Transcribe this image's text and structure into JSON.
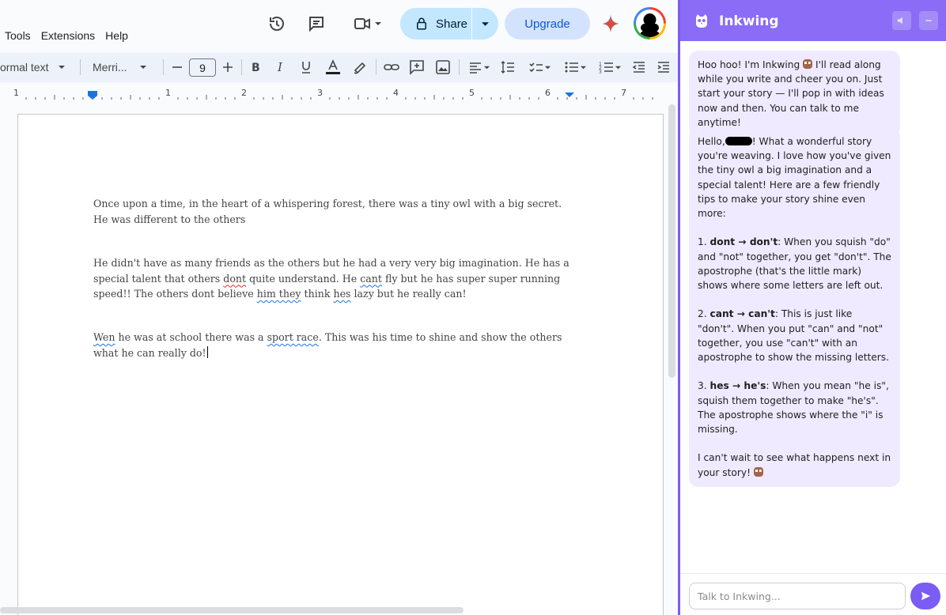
{
  "docs": {
    "menu": [
      "Tools",
      "Extensions",
      "Help"
    ],
    "share_label": "Share",
    "upgrade_label": "Upgrade",
    "toolbar": {
      "style_label": "ormal text",
      "font_label": "Merri...",
      "font_size": "9"
    },
    "ruler_numbers": [
      "1",
      "1",
      "2",
      "3",
      "4",
      "5",
      "6",
      "7"
    ],
    "document": {
      "paragraph1": "Once upon a time, in the heart of a whispering forest, there was a tiny owl with a big secret. He was different to the others",
      "p2": {
        "a": "He didn't have as many friends as the others but he had a very very big imagination. He has a special talent that others ",
        "b": "dont",
        "c": " quite understand. He ",
        "d": "cant",
        "e": " fly but he has super super running speed!! The others dont believe ",
        "f": "him they",
        "g": " think ",
        "h": "hes",
        "i": " lazy but he really can!"
      },
      "p3": {
        "a": "Wen",
        "b": " he was at school there was a ",
        "c": "sport race",
        "d": ". This was his time to shine and show the others what he can really do!"
      }
    }
  },
  "panel": {
    "title": "Inkwing",
    "accent_color": "#8a6cf7",
    "bubble1": "Hoo hoo! I'm Inkwing",
    "bubble1_rest": " I'll read along while you write and cheer you on. Just start your story — I'll pop in with ideas now and then. You can talk to me anytime!",
    "bubble2": {
      "hello": "Hello,",
      "intro": "! What a wonderful story you're weaving. I love how you've given the tiny owl a big imagination and a special talent! Here are a few friendly tips to make your story shine even more:",
      "tip1_num": "1. ",
      "tip1_bold": "dont → don't",
      "tip1_text": ": When you squish \"do\" and \"not\" together, you get \"don't\". The apostrophe (that's the little mark) shows where some letters are left out.",
      "tip2_num": "2. ",
      "tip2_bold": "cant → can't",
      "tip2_text": ": This is just like \"don't\". When you put \"can\" and \"not\" together, you use \"can't\" with an apostrophe to show the missing letters.",
      "tip3_num": "3. ",
      "tip3_bold": "hes → he's",
      "tip3_text": ": When you mean \"he is\", squish them together to make \"he's\". The apostrophe shows where the \"i\" is missing.",
      "closing": "I can't wait to see what happens next in your story!"
    },
    "input_placeholder": "Talk to Inkwing..."
  }
}
